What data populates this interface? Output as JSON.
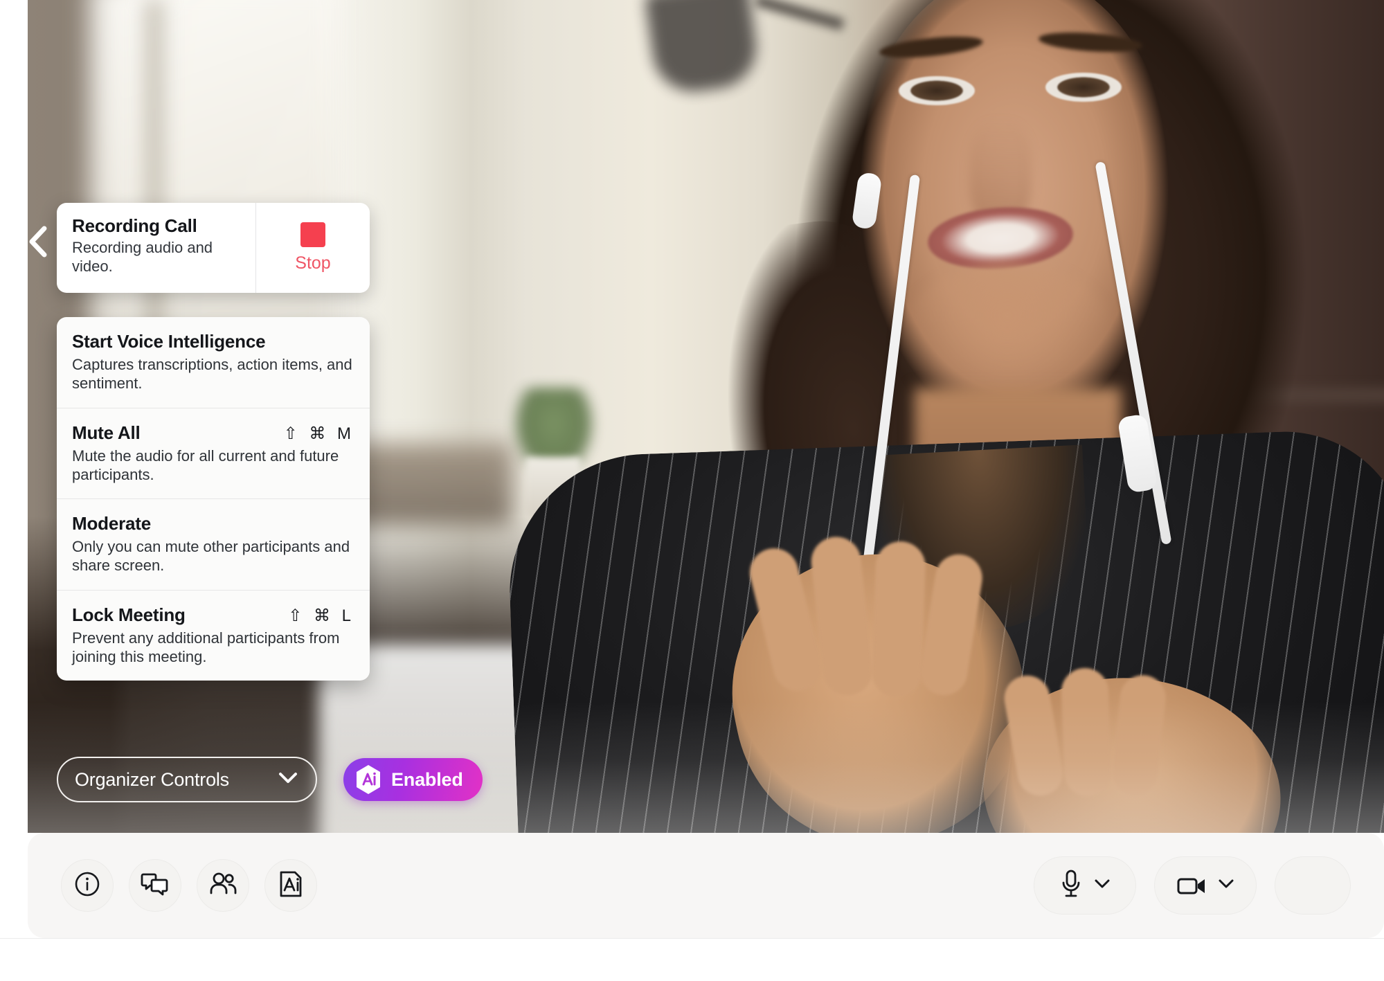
{
  "video": {
    "alt": "video-call-participant",
    "description": "Woman wearing white earbuds on a video call in a bright room"
  },
  "back_control": {
    "icon": "chevron-left-icon"
  },
  "recording_card": {
    "title": "Recording Call",
    "subtitle": "Recording audio and video.",
    "stop_label": "Stop",
    "stop_icon": "stop-square-icon",
    "stop_color": "#f5404f",
    "stop_text_color": "#ef5565"
  },
  "organizer_menu": {
    "items": [
      {
        "title": "Start Voice Intelligence",
        "description": "Captures transcriptions, action items, and sentiment.",
        "shortcut": ""
      },
      {
        "title": "Mute All",
        "description": "Mute the audio for all current and future participants.",
        "shortcut": "⇧ ⌘ M"
      },
      {
        "title": "Moderate",
        "description": "Only you can mute other participants and share screen.",
        "shortcut": ""
      },
      {
        "title": "Lock Meeting",
        "description": "Prevent any additional participants from joining this meeting.",
        "shortcut": "⇧ ⌘ L"
      }
    ]
  },
  "controls_row": {
    "organizer_select": {
      "label": "Organizer Controls",
      "chevron_icon": "chevron-down-icon"
    },
    "enabled_badge": {
      "label": "Enabled",
      "icon": "ai-hexagon-icon",
      "gradient_from": "#8b3fe8",
      "gradient_to": "#e231c6"
    }
  },
  "toolbar": {
    "left_buttons": [
      {
        "name": "meeting-info",
        "icon": "info-circle-icon"
      },
      {
        "name": "chat",
        "icon": "chat-bubbles-icon"
      },
      {
        "name": "participants",
        "icon": "people-icon"
      },
      {
        "name": "voice-intelligence",
        "icon": "ai-note-icon"
      }
    ],
    "right_buttons": [
      {
        "name": "microphone",
        "icon": "microphone-icon",
        "chevron": "chevron-down-icon"
      },
      {
        "name": "camera",
        "icon": "video-camera-icon",
        "chevron": "chevron-down-icon"
      },
      {
        "name": "more",
        "icon": "pill-partial-icon",
        "chevron": ""
      }
    ]
  }
}
